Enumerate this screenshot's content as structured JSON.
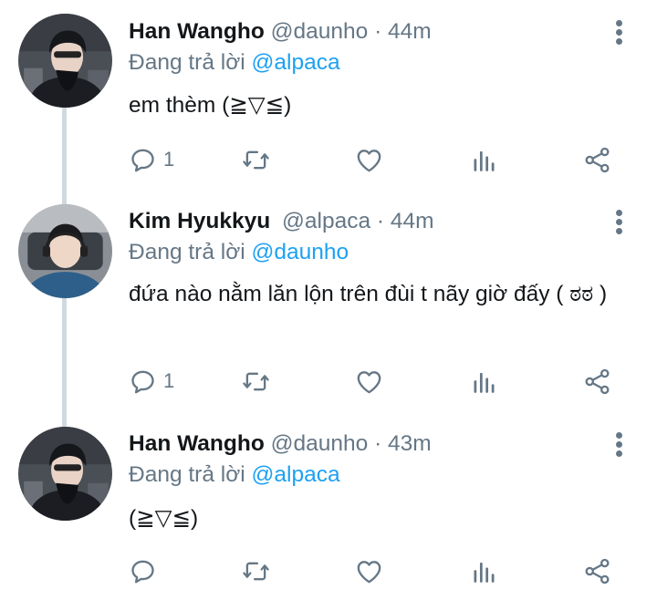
{
  "tweets": [
    {
      "name": "Han Wangho",
      "handle": "@daunho",
      "time": "· 44m",
      "replying_prefix": "Đang trả lời",
      "replying_to": "@alpaca",
      "text": "em thèm (≧▽≦)",
      "reply_count": "1"
    },
    {
      "name": "Kim Hyukkyu",
      "handle": "@alpaca",
      "time": "· 44m",
      "replying_prefix": "Đang trả lời",
      "replying_to": "@daunho",
      "text": "đứa nào nằm lăn lộn trên đùi t nãy giờ đấy ( ಠಠ )",
      "reply_count": "1"
    },
    {
      "name": "Han Wangho",
      "handle": "@daunho",
      "time": "· 43m",
      "replying_prefix": "Đang trả lời",
      "replying_to": "@alpaca",
      "text": "(≧▽≦)",
      "reply_count": ""
    }
  ],
  "icons": {
    "reply": "reply-icon",
    "retweet": "retweet-icon",
    "like": "heart-icon",
    "analytics": "analytics-icon",
    "share": "share-icon",
    "more": "more-vertical-icon"
  },
  "colors": {
    "text": "#14171a",
    "secondary": "#657786",
    "mention": "#1da1f2",
    "thread_line": "#cfd9de"
  }
}
